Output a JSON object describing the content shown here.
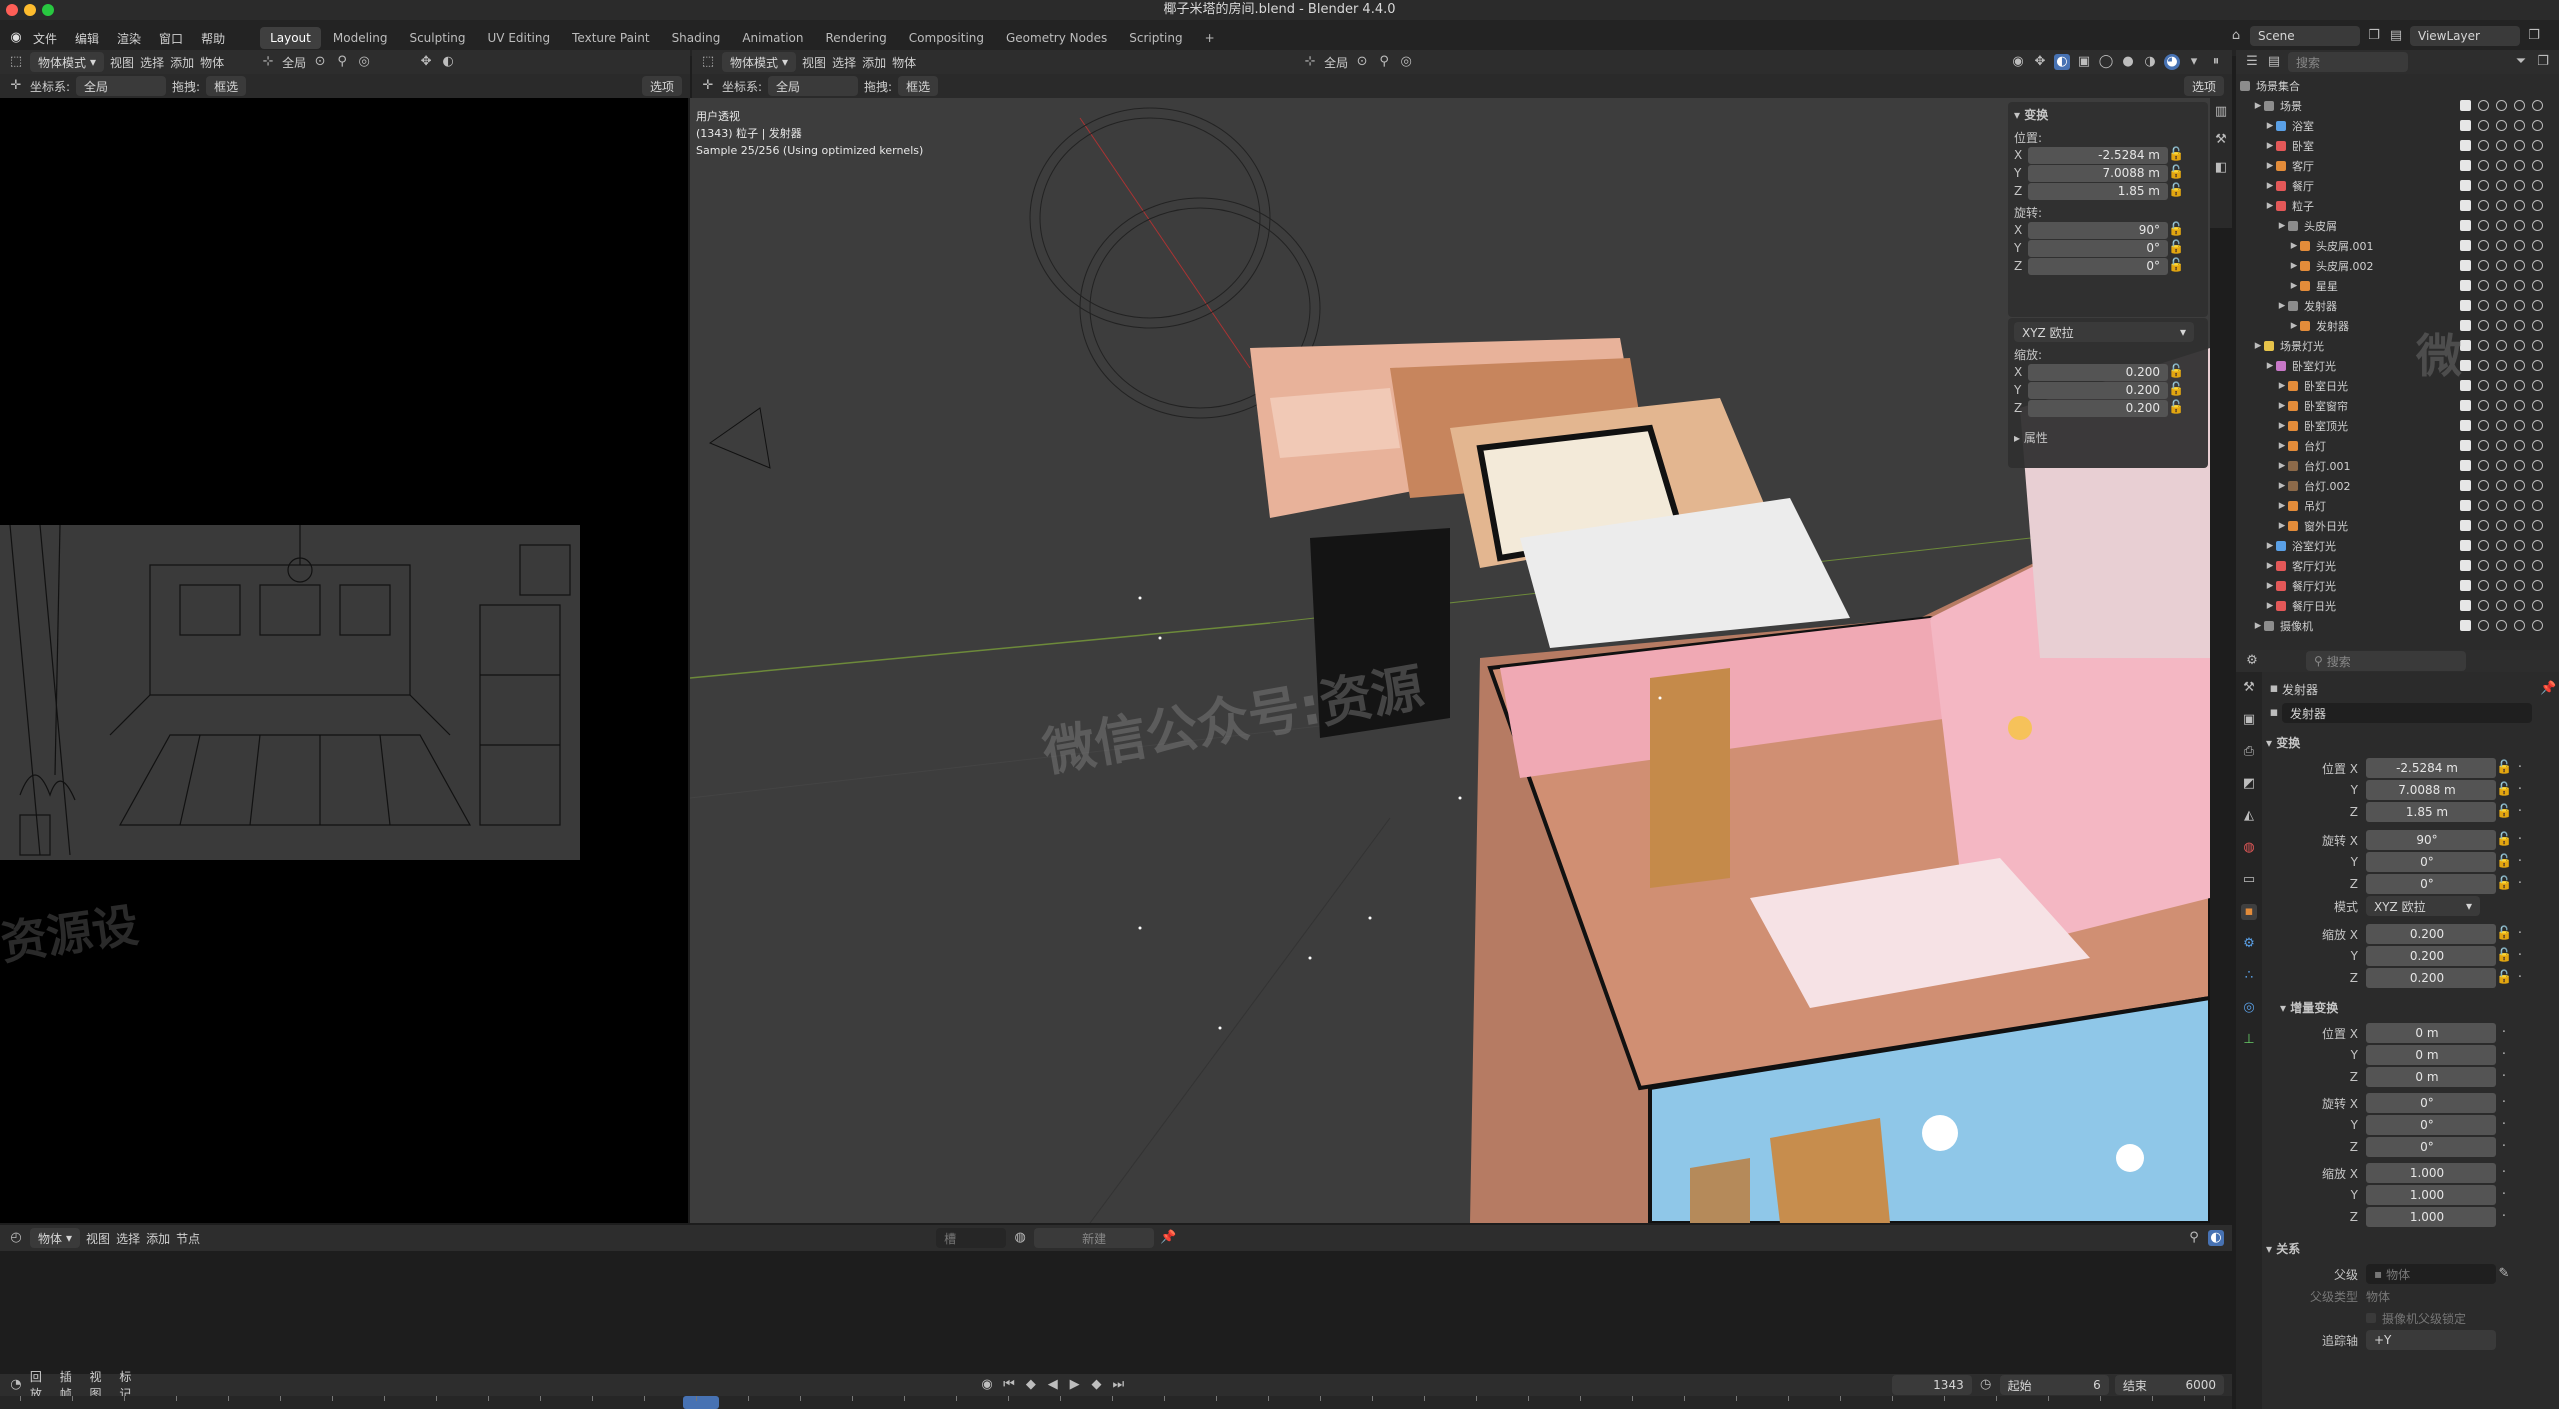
{
  "window": {
    "title": "椰子米塔的房间.blend - Blender 4.4.0"
  },
  "menu": {
    "items": [
      "文件",
      "编辑",
      "渲染",
      "窗口",
      "帮助"
    ]
  },
  "workspaces": [
    "Layout",
    "Modeling",
    "Sculpting",
    "UV Editing",
    "Texture Paint",
    "Shading",
    "Animation",
    "Rendering",
    "Compositing",
    "Geometry Nodes",
    "Scripting"
  ],
  "scene": {
    "name": "Scene",
    "view_layer": "ViewLayer"
  },
  "left_view": {
    "mode": "物体模式",
    "menu": [
      "视图",
      "选择",
      "添加",
      "物体"
    ],
    "orient_label": "坐标系:",
    "orient_value": "全局",
    "drag_label": "拖拽:",
    "drag_value": "框选",
    "global": "全局",
    "options": "选项"
  },
  "viewport": {
    "mode": "物体模式",
    "menu": [
      "视图",
      "选择",
      "添加",
      "物体"
    ],
    "orient_label": "坐标系:",
    "orient_value": "全局",
    "drag_label": "拖拽:",
    "drag_value": "框选",
    "global": "全局",
    "options": "选项",
    "info_view": "用户透视",
    "info_object": "(1343) 粒子 | 发射器",
    "info_sample": "Sample 25/256 (Using optimized kernels)",
    "watermark": "微信公众号:资源"
  },
  "left_watermark": "资源设",
  "outliner_watermark": "微",
  "n_panel": {
    "section": "变换",
    "location_label": "位置:",
    "location": [
      "-2.5284 m",
      "7.0088 m",
      "1.85 m"
    ],
    "rotation_label": "旋转:",
    "rotation": [
      "90°",
      "0°",
      "0°"
    ],
    "rotation_mode": "XYZ 欧拉",
    "scale_label": "缩放:",
    "scale": [
      "0.200",
      "0.200",
      "0.200"
    ],
    "properties": "属性",
    "axes": [
      "X",
      "Y",
      "Z"
    ]
  },
  "outliner": {
    "search_placeholder": "搜索",
    "root": "场景集合",
    "rows": [
      {
        "label": "场景",
        "indent": 1,
        "color": "#8c8c8c"
      },
      {
        "label": "浴室",
        "indent": 2,
        "color": "#5aa0e6"
      },
      {
        "label": "卧室",
        "indent": 2,
        "color": "#e35858"
      },
      {
        "label": "客厅",
        "indent": 2,
        "color": "#e38c3a"
      },
      {
        "label": "餐厅",
        "indent": 2,
        "color": "#e35858"
      },
      {
        "label": "粒子",
        "indent": 2,
        "color": "#e35858"
      },
      {
        "label": "头皮屑",
        "indent": 3,
        "color": "#8c8c8c"
      },
      {
        "label": "头皮屑.001",
        "indent": 4,
        "color": "#e38c3a"
      },
      {
        "label": "头皮屑.002",
        "indent": 4,
        "color": "#e38c3a"
      },
      {
        "label": "星星",
        "indent": 4,
        "color": "#e38c3a"
      },
      {
        "label": "发射器",
        "indent": 3,
        "color": "#8c8c8c"
      },
      {
        "label": "发射器",
        "indent": 4,
        "color": "#e38c3a"
      },
      {
        "label": "场景灯光",
        "indent": 1,
        "color": "#e6c34a"
      },
      {
        "label": "卧室灯光",
        "indent": 2,
        "color": "#c878c8"
      },
      {
        "label": "卧室日光",
        "indent": 3,
        "color": "#e38c3a"
      },
      {
        "label": "卧室窗帘",
        "indent": 3,
        "color": "#e38c3a"
      },
      {
        "label": "卧室顶光",
        "indent": 3,
        "color": "#e38c3a"
      },
      {
        "label": "台灯",
        "indent": 3,
        "color": "#e38c3a"
      },
      {
        "label": "台灯.001",
        "indent": 3,
        "color": "#8c6a4a"
      },
      {
        "label": "台灯.002",
        "indent": 3,
        "color": "#8c6a4a"
      },
      {
        "label": "吊灯",
        "indent": 3,
        "color": "#e38c3a"
      },
      {
        "label": "窗外日光",
        "indent": 3,
        "color": "#e38c3a"
      },
      {
        "label": "浴室灯光",
        "indent": 2,
        "color": "#5aa0e6"
      },
      {
        "label": "客厅灯光",
        "indent": 2,
        "color": "#e35858"
      },
      {
        "label": "餐厅灯光",
        "indent": 2,
        "color": "#e35858"
      },
      {
        "label": "餐厅日光",
        "indent": 2,
        "color": "#e35858"
      },
      {
        "label": "摄像机",
        "indent": 1,
        "color": "#8c8c8c"
      }
    ]
  },
  "properties": {
    "search_placeholder": "搜索",
    "object_name": "发射器",
    "data_name": "发射器",
    "transform_title": "变换",
    "location_label": "位置 X",
    "location": [
      "-2.5284 m",
      "7.0088 m",
      "1.85 m"
    ],
    "rotation_label": "旋转 X",
    "rotation": [
      "90°",
      "0°",
      "0°"
    ],
    "mode_label": "模式",
    "mode_value": "XYZ 欧拉",
    "scale_label": "缩放 X",
    "scale": [
      "0.200",
      "0.200",
      "0.200"
    ],
    "delta_title": "增量变换",
    "delta_location": [
      "0 m",
      "0 m",
      "0 m"
    ],
    "delta_rotation": [
      "0°",
      "0°",
      "0°"
    ],
    "delta_scale": [
      "1.000",
      "1.000",
      "1.000"
    ],
    "relations_title": "关系",
    "parent_label": "父级",
    "parent_placeholder": "物体",
    "parent_type_label": "父级类型",
    "parent_type_value": "物体",
    "camera_parent_lock": "摄像机父级锁定",
    "track_axis_label": "追踪轴",
    "track_axis_value": "+Y",
    "y": "Y",
    "z": "Z"
  },
  "node_editor": {
    "mode": "物体",
    "menu": [
      "视图",
      "选择",
      "添加",
      "节点"
    ],
    "slot": "槽",
    "new": "新建"
  },
  "timeline": {
    "menu": [
      "回放",
      "插帧",
      "视图",
      "标记"
    ],
    "current_frame": "1343",
    "start_label": "起始",
    "start": "6",
    "end_label": "结束",
    "end": "6000"
  }
}
